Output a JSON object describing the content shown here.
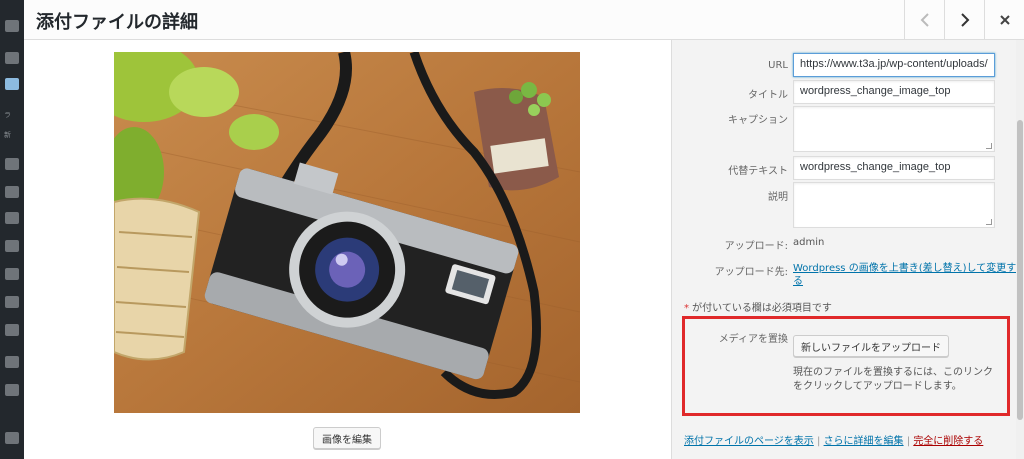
{
  "modal": {
    "title": "添付ファイルの詳細",
    "prev_icon": "chevron-left-icon",
    "next_icon": "chevron-right-icon",
    "close_icon": "close-icon"
  },
  "image_pane": {
    "edit_button": "画像を編集"
  },
  "details": {
    "url_label": "URL",
    "url_value": "https://www.t3a.jp/wp-content/uploads/",
    "title_label": "タイトル",
    "title_value": "wordpress_change_image_top",
    "caption_label": "キャプション",
    "caption_value": "",
    "alt_label": "代替テキスト",
    "alt_value": "wordpress_change_image_top",
    "description_label": "説明",
    "description_value": "",
    "uploader_label": "アップロード:",
    "uploader_value": "admin",
    "uploaded_to_label": "アップロード先:",
    "uploaded_to_link_line1": "Wordpress の画像を上書き(差し替え)して変更す",
    "uploaded_to_link_line2": "る",
    "required_star": "*",
    "required_note": " が付いている欄は必須項目です",
    "replace_label": "メディアを置換",
    "replace_button": "新しいファイルをアップロード",
    "replace_desc_line1": "現在のファイルを置換するには、このリンク",
    "replace_desc_line2": "をクリックしてアップロードします。",
    "view_page_link": "添付ファイルのページを表示",
    "separator": "|",
    "edit_more_link": "さらに詳細を編集",
    "delete_link": "完全に削除する"
  },
  "sidebar_hint": {
    "text_a": "ラ",
    "text_b": "新"
  },
  "colors": {
    "accent": "#0073aa",
    "highlight_box": "#e0292a",
    "delete": "#a00"
  }
}
